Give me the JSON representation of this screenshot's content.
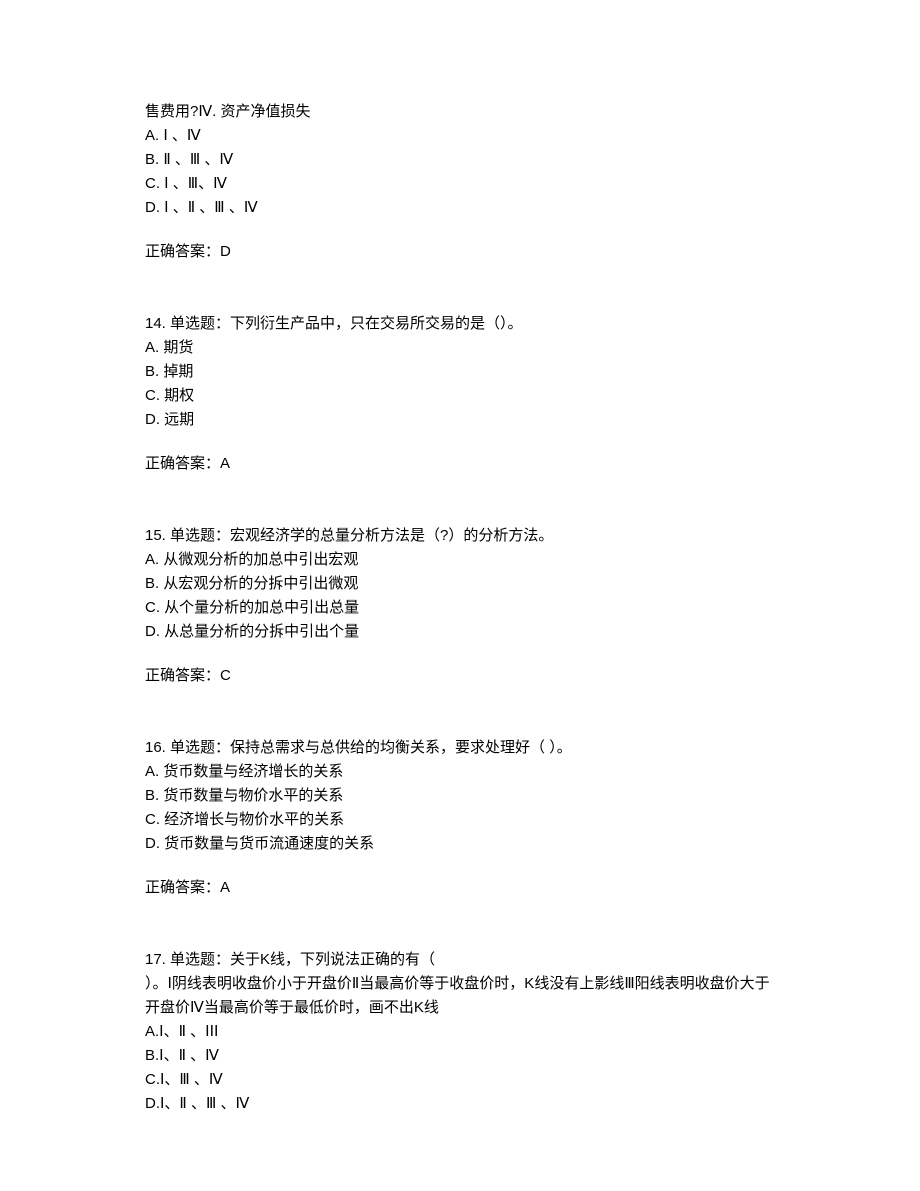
{
  "q13": {
    "fragment": "售费用?Ⅳ. 资产净值损失",
    "optA": "A. Ⅰ 、Ⅳ",
    "optB": "B. Ⅱ 、Ⅲ 、Ⅳ",
    "optC": "C. Ⅰ 、Ⅲ、Ⅳ",
    "optD": "D. Ⅰ 、Ⅱ 、Ⅲ 、Ⅳ",
    "answer": "正确答案：D"
  },
  "q14": {
    "stem": "14.  单选题：下列衍生产品中，只在交易所交易的是（）。",
    "optA": "A. 期货",
    "optB": "B. 掉期",
    "optC": "C. 期权",
    "optD": "D. 远期",
    "answer": "正确答案：A"
  },
  "q15": {
    "stem": "15.  单选题：宏观经济学的总量分析方法是（?）的分析方法。",
    "optA": "A. 从微观分析的加总中引出宏观",
    "optB": "B. 从宏观分析的分拆中引出微观",
    "optC": "C. 从个量分析的加总中引出总量",
    "optD": "D. 从总量分析的分拆中引出个量",
    "answer": "正确答案：C"
  },
  "q16": {
    "stem": "16.  单选题：保持总需求与总供给的均衡关系，要求处理好（   ）。",
    "optA": "A. 货币数量与经济增长的关系",
    "optB": "B. 货币数量与物价水平的关系",
    "optC": "C. 经济增长与物价水平的关系",
    "optD": "D. 货币数量与货币流通速度的关系",
    "answer": "正确答案：A"
  },
  "q17": {
    "stem1": "17.  单选题：关于K线，下列说法正确的有（",
    "stem2": "）。Ⅰ阴线表明收盘价小于开盘价Ⅱ当最高价等于收盘价时，K线没有上影线Ⅲ阳线表明收盘价大于开盘价Ⅳ当最高价等于最低价时，画不出K线",
    "optA": "A.Ⅰ、Ⅱ 、ⅠⅠⅠ",
    "optB": "B.Ⅰ、Ⅱ 、Ⅳ",
    "optC": "C.Ⅰ、Ⅲ 、Ⅳ",
    "optD": "D.Ⅰ、Ⅱ 、Ⅲ 、Ⅳ"
  }
}
